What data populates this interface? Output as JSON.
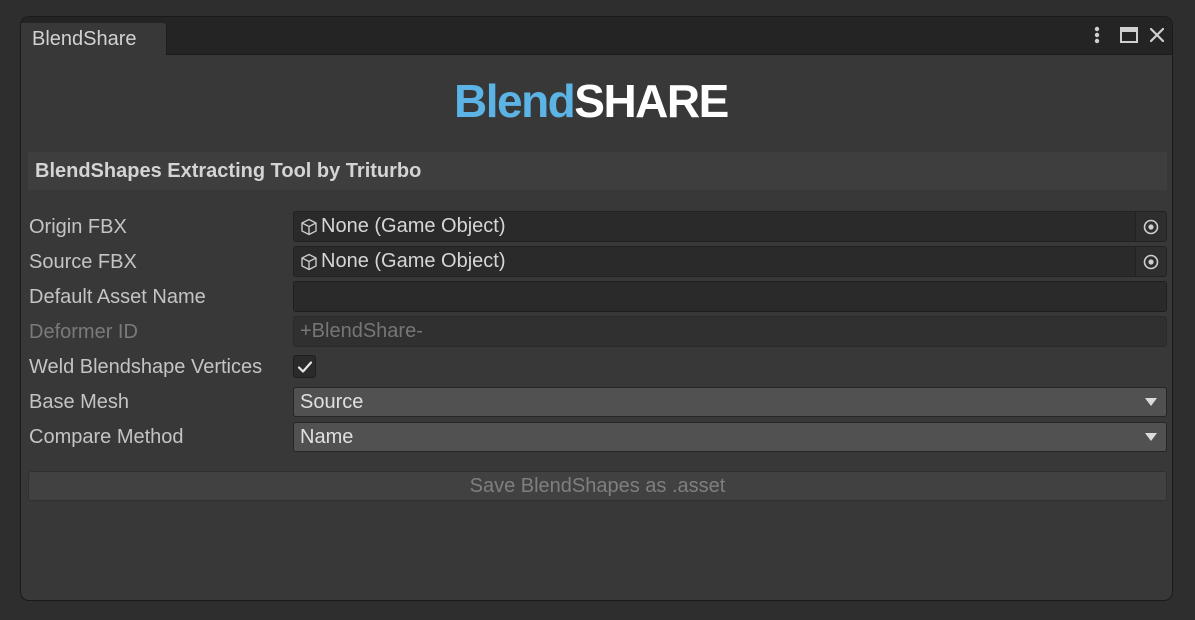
{
  "window": {
    "tab_title": "BlendShare",
    "controls": [
      "more-options-icon",
      "maximize-icon",
      "close-icon"
    ]
  },
  "logo": {
    "part1": "Blend",
    "part2": "SHARE",
    "color_blend": "#5bb3e6",
    "color_share": "#ffffff"
  },
  "header": {
    "title": "BlendShapes Extracting Tool by Triturbo"
  },
  "fields": {
    "origin_fbx": {
      "label": "Origin FBX",
      "value": "None (Game Object)"
    },
    "source_fbx": {
      "label": "Source FBX",
      "value": "None (Game Object)"
    },
    "default_asset_name": {
      "label": "Default Asset Name",
      "value": ""
    },
    "deformer_id": {
      "label": "Deformer ID",
      "value": "+BlendShare-",
      "disabled": true
    },
    "weld_vertices": {
      "label": "Weld Blendshape Vertices",
      "checked": true
    },
    "base_mesh": {
      "label": "Base Mesh",
      "value": "Source"
    },
    "compare_method": {
      "label": "Compare Method",
      "value": "Name"
    }
  },
  "save_button": {
    "label": "Save BlendShapes as .asset",
    "disabled": true
  }
}
